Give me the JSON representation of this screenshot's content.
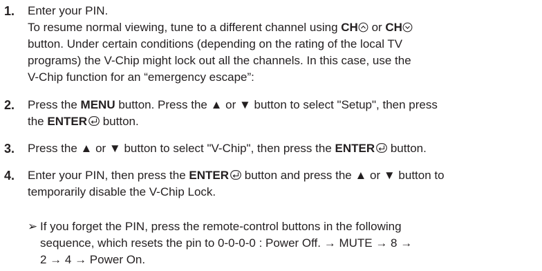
{
  "steps": [
    {
      "num": "1.",
      "line1": "Enter your PIN.",
      "line2_a": "To resume normal viewing, tune to a different channel using ",
      "line2_ch": "CH",
      "line2_or": " or ",
      "line2_ch2": "CH",
      "line3": "button. Under certain conditions (depending on the rating of the local TV",
      "line4": "programs) the V-Chip might lock out all the channels. In this case, use the",
      "line5": "V-Chip function for an “emergency escape”:"
    },
    {
      "num": "2.",
      "a": "Press the ",
      "menu": "MENU",
      "b": " button. Press the ▲ or ▼ button to select \"Setup\", then press",
      "c": "the ",
      "enter": "ENTER",
      "d": " button."
    },
    {
      "num": "3.",
      "a": "Press the ▲ or ▼ button to select \"V-Chip\", then press the ",
      "enter": "ENTER",
      "b": " button."
    },
    {
      "num": "4.",
      "a": "Enter your PIN, then press the ",
      "enter": "ENTER",
      "b": " button and press the ▲ or ▼ button to",
      "c": "temporarily disable the V-Chip Lock."
    }
  ],
  "note": {
    "marker": "➢",
    "line1": "If you forget the PIN, press the remote-control buttons in the following",
    "line2": "sequence, which resets the pin to 0-0-0-0 : Power Off. → MUTE → 8 →",
    "line3": "2 → 4 → Power On."
  },
  "icons": {
    "ch_up": "chevron-up-circle-icon",
    "ch_down": "chevron-down-circle-icon",
    "enter": "enter-icon"
  }
}
